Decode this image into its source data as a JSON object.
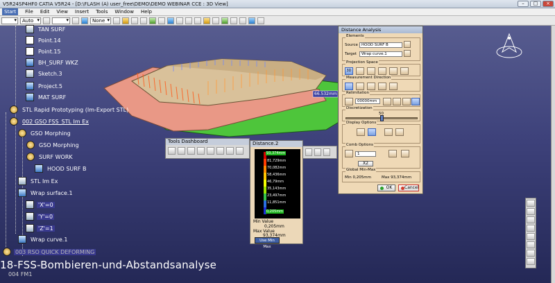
{
  "window": {
    "title": "V5R24SP4HF0 CATIA V5R24 - [D:\\FLASH (A) user_free\\DEMO\\DEMO WEBINAR CCE : 3D View]"
  },
  "menu": [
    "Start",
    "File",
    "Edit",
    "View",
    "Insert",
    "Tools",
    "Window",
    "Help"
  ],
  "toolbar": {
    "combo1": "",
    "combo2": "Auto",
    "combo3": "None"
  },
  "tree": {
    "items": [
      {
        "label": "TAN SURF"
      },
      {
        "label": "Point.14"
      },
      {
        "label": "Point.15"
      },
      {
        "label": "BH_SURF WKZ"
      },
      {
        "label": "Sketch.3"
      },
      {
        "label": "Project.5"
      },
      {
        "label": "MAT SURF"
      },
      {
        "label": "STL Rapid Prototyping (Im-Export STL)"
      },
      {
        "label": "002 GSO FSS_STL Im Ex"
      },
      {
        "label": "GSO Morphing"
      },
      {
        "label": "GSO Morphing"
      },
      {
        "label": "SURF WORK"
      },
      {
        "label": "HOOD SURF B"
      },
      {
        "label": "STL Im Ex"
      },
      {
        "label": "Wrap surface.1"
      },
      {
        "label": "'X'=0"
      },
      {
        "label": "'Y'=0"
      },
      {
        "label": "'Z'=1"
      },
      {
        "label": "Wrap curve.1"
      },
      {
        "label": "003 RSO QUICK DEFORMING"
      },
      {
        "label": "004 FM1"
      }
    ]
  },
  "viewport": {
    "distance_tag": "66.532mm"
  },
  "tools_dashboard": {
    "title": "Tools Dashboard"
  },
  "distance_scale": {
    "title": "Distance.2",
    "ticks": [
      "93,374mm",
      "81,729mm",
      "70,082mm",
      "58,436mm",
      "46,79mm",
      "35,143mm",
      "23,497mm",
      "11,851mm",
      "0,205mm"
    ],
    "min_label": "Min Value",
    "min_value": "0,205mm",
    "max_label": "Max Value",
    "max_value": "93,374mm",
    "use_button": "Use Min Max"
  },
  "dialog": {
    "title": "Distance Analysis",
    "elements_label": "Elements",
    "source_label": "Source",
    "source_value": "HOOD SURF B",
    "target_label": "Target",
    "target_value": "Wrap curve.1",
    "projection_label": "Projection Space",
    "projection_mode": "3D",
    "measurement_label": "Measurement Direction",
    "relimitation_label": "Relimitation",
    "relimitation_value": "00000mm",
    "discretization_label": "Discretization",
    "discretization_value": "50",
    "display_label": "Display Options",
    "comb_label": "Comb Options",
    "comb_value": "1",
    "comb_scale": "X2",
    "global_label": "Global Min-Max",
    "global_min": "Min 0,205mm",
    "global_max": "Max 93,374mm",
    "ok_label": "OK",
    "cancel_label": "Cancel"
  },
  "caption": "18-FSS-Bombieren-und-Abstandsanalyse",
  "colors": {
    "viewport_top": "#575c8f",
    "viewport_bottom": "#242856",
    "dialog_bg": "#efd9b6",
    "accent": "#1db51d"
  }
}
